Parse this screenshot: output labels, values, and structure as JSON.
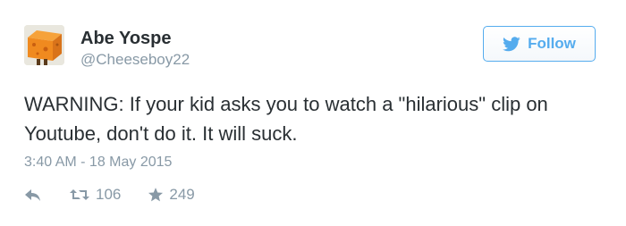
{
  "user": {
    "display_name": "Abe Yospe",
    "username": "@Cheeseboy22",
    "avatar_icon": "cheese-block-avatar"
  },
  "follow_button": {
    "label": "Follow",
    "icon": "twitter-bird-icon",
    "color": "#55acee"
  },
  "tweet": {
    "text": "WARNING: If your kid asks you to watch a \"hilarious\" clip on Youtube, don't do it. It will suck.",
    "timestamp": "3:40 AM - 18 May 2015"
  },
  "actions": {
    "reply_icon": "reply-icon",
    "retweet_icon": "retweet-icon",
    "retweet_count": "106",
    "favorite_icon": "star-icon",
    "favorite_count": "249"
  },
  "colors": {
    "text": "#292f33",
    "muted": "#8899a6",
    "accent": "#55acee"
  }
}
